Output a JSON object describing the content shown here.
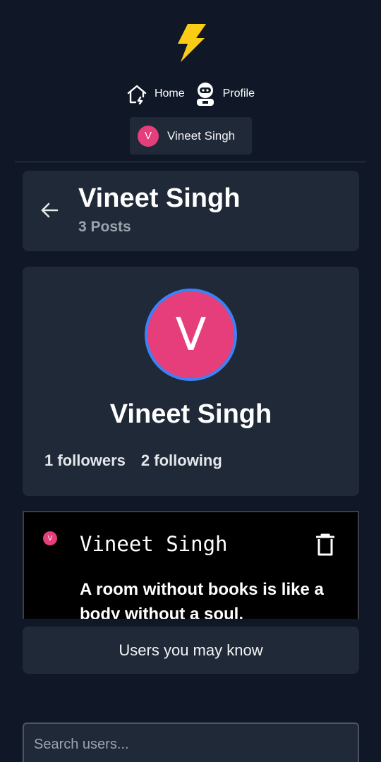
{
  "nav": {
    "home_label": "Home",
    "profile_label": "Profile"
  },
  "current_user": {
    "initial": "V",
    "name": "Vineet Singh"
  },
  "header": {
    "title": "Vineet Singh",
    "post_count": "3 Posts"
  },
  "profile": {
    "initial": "V",
    "name": "Vineet Singh",
    "followers": "1 followers",
    "following": "2 following"
  },
  "post": {
    "author_initial": "V",
    "author_name": "Vineet Singh",
    "text": "A room without books is like a body without a soul."
  },
  "suggestions": {
    "title": "Users you may know"
  },
  "search": {
    "placeholder": "Search users..."
  },
  "colors": {
    "background": "#101827",
    "card": "#1f2937",
    "avatar": "#e53e7a",
    "avatar_ring": "#3b82f6",
    "logo": "#facc15"
  },
  "icons": {
    "logo": "lightning-bolt-icon",
    "home": "home-icon",
    "profile": "astronaut-icon",
    "back": "arrow-left-icon",
    "delete": "trash-icon"
  }
}
